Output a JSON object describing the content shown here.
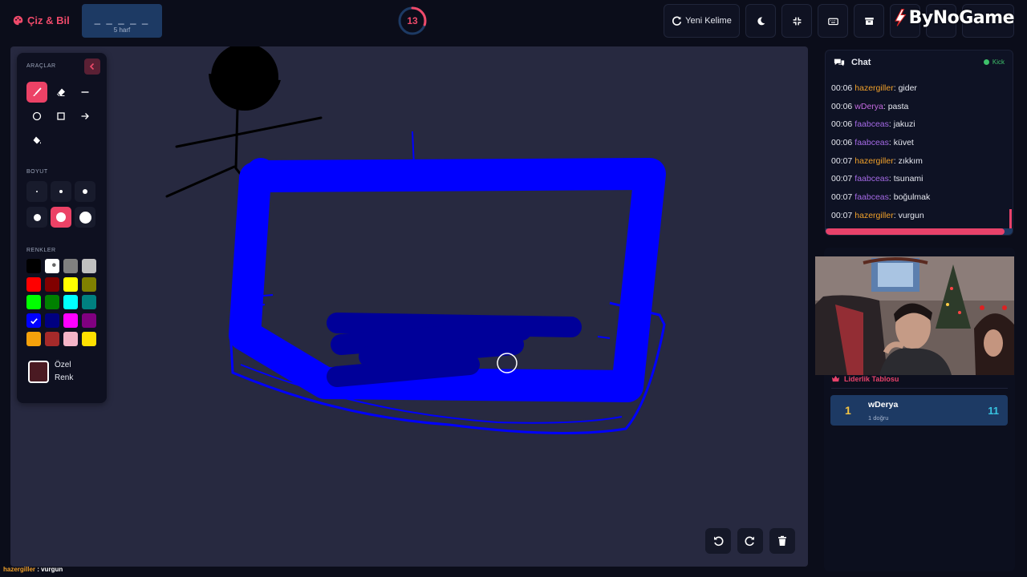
{
  "app": {
    "brand": "Çiz & Bil"
  },
  "word": {
    "mask": "_ _ _ _ _",
    "length_label": "5 harf"
  },
  "timer": {
    "value": "13",
    "fraction_remaining": 0.3
  },
  "toolbar": {
    "new_word_label": "Yeni Kelime",
    "buttons": [
      "moon-icon",
      "compress-icon",
      "keyboard-icon",
      "archive-icon",
      "exit-icon"
    ]
  },
  "watermark": {
    "text": "ByNoGame"
  },
  "tools_panel": {
    "tools_title": "ARAÇLAR",
    "size_title": "BOYUT",
    "colors_title": "RENKLER",
    "custom_color_label": "Özel Renk",
    "active_tool": "brush",
    "active_size_index": 4,
    "selected_color": "#0000ff",
    "custom_color": "#4a1a22",
    "colors": [
      "#000000",
      "#ffffff",
      "#808080",
      "#c0c0c0",
      "#ff0000",
      "#800000",
      "#ffff00",
      "#808000",
      "#00ff00",
      "#008000",
      "#00ffff",
      "#008080",
      "#0000ff",
      "#000080",
      "#ff00ff",
      "#800080",
      "#f5a10b",
      "#a52a2a",
      "#f5b5c8",
      "#ffe000"
    ]
  },
  "chat": {
    "title": "Chat",
    "platform": "Kick",
    "scroll_fraction": 0.95,
    "messages": [
      {
        "time": "00:06",
        "user": "hazergiller",
        "color": "#f0a02a",
        "text": ": gider"
      },
      {
        "time": "00:06",
        "user": "wDerya",
        "color": "#c46ae0",
        "text": ": pasta"
      },
      {
        "time": "00:06",
        "user": "faabceas",
        "color": "#a56ae6",
        "text": ": jakuzi"
      },
      {
        "time": "00:06",
        "user": "faabceas",
        "color": "#a56ae6",
        "text": ": küvet"
      },
      {
        "time": "00:07",
        "user": "hazergiller",
        "color": "#f0a02a",
        "text": ": zıkkım"
      },
      {
        "time": "00:07",
        "user": "faabceas",
        "color": "#a56ae6",
        "text": ": tsunami"
      },
      {
        "time": "00:07",
        "user": "faabceas",
        "color": "#a56ae6",
        "text": ": boğulmak"
      },
      {
        "time": "00:07",
        "user": "hazergiller",
        "color": "#f0a02a",
        "text": ": vurgun"
      }
    ]
  },
  "leaderboard": {
    "title": "Liderlik Tablosu",
    "rows": [
      {
        "rank": "1",
        "name": "wDerya",
        "sub": "1 doğru",
        "score": "11"
      }
    ]
  },
  "status_bar": {
    "user": "hazergiller",
    "text": " : vurgun"
  }
}
